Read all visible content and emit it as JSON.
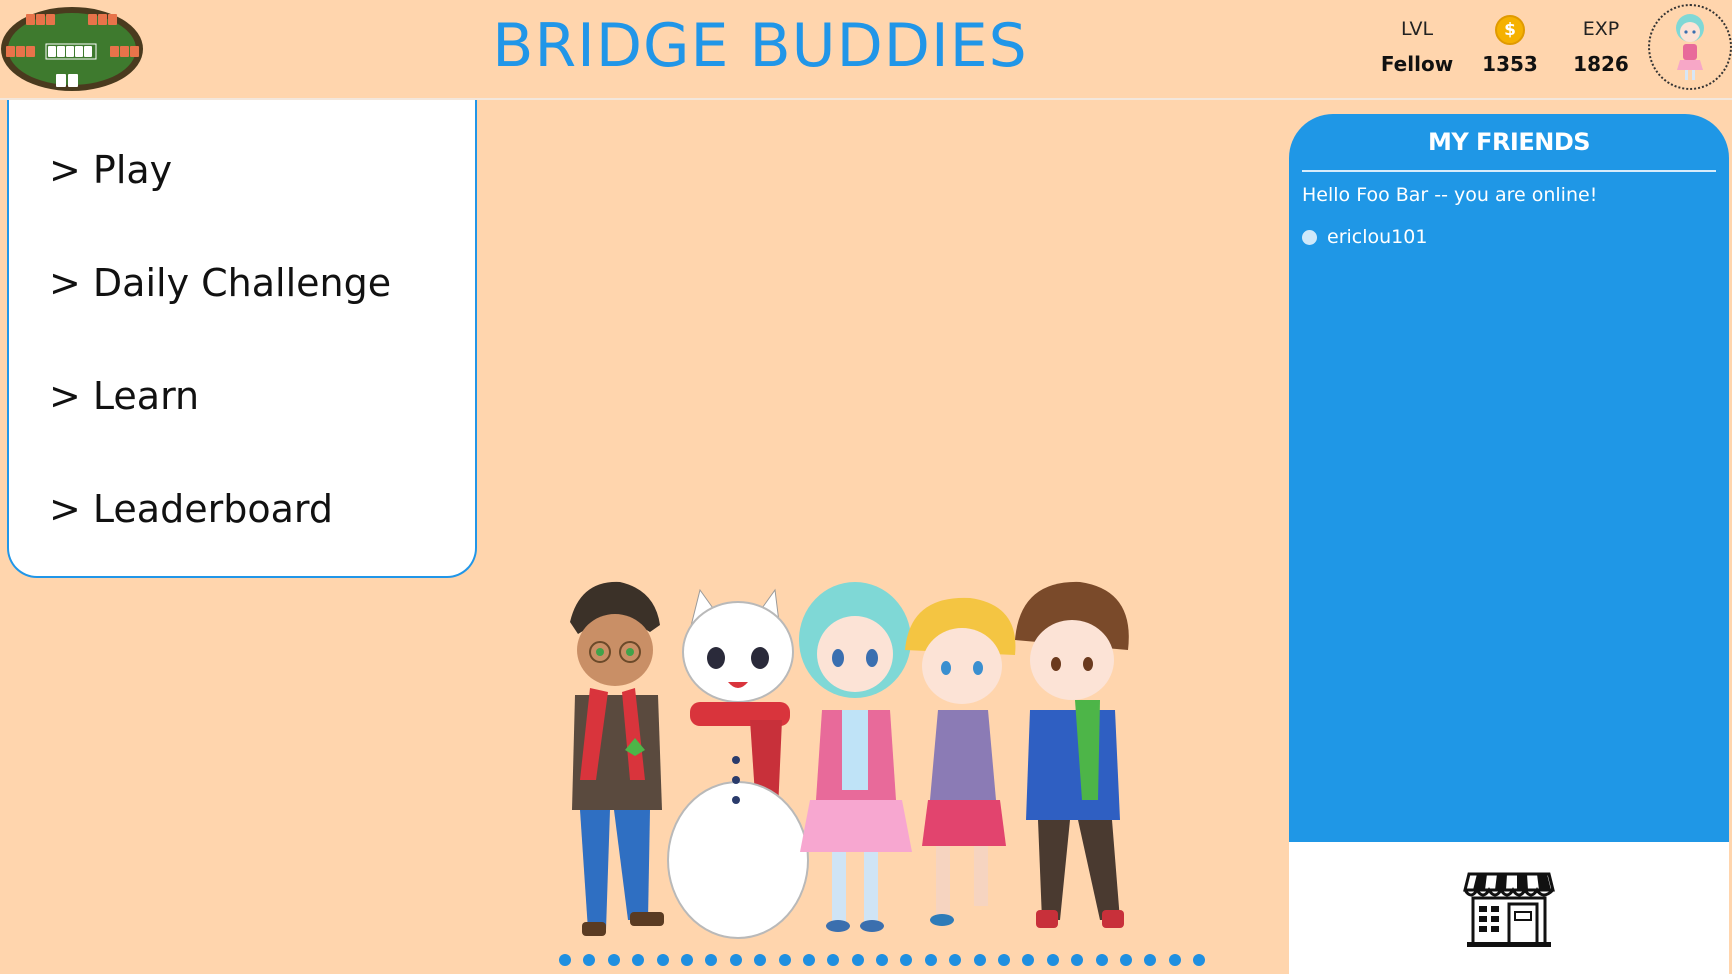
{
  "header": {
    "title": "BRIDGE BUDDIES",
    "logo_icon": "card-table-icon",
    "stats": {
      "level_label": "LVL",
      "level_value": "Fellow",
      "coins_icon": "coin-icon",
      "coins_symbol": "$",
      "coins_value": "1353",
      "exp_label": "EXP",
      "exp_value": "1826"
    },
    "avatar_icon": "avatar-icon"
  },
  "menu": {
    "items": [
      {
        "label": "> Play"
      },
      {
        "label": "> Daily Challenge"
      },
      {
        "label": "> Learn"
      },
      {
        "label": "> Leaderboard"
      }
    ]
  },
  "friends": {
    "title": "MY FRIENDS",
    "status_message": "Hello Foo Bar -- you are online!",
    "list": [
      {
        "name": "ericlou101",
        "status": "online"
      }
    ]
  },
  "shop": {
    "icon": "shop-icon"
  },
  "carousel": {
    "dot_count": 27
  },
  "colors": {
    "background": "#FFD5AD",
    "accent": "#2196E8",
    "friends_panel": "#1F97E6",
    "coin": "#F5B100"
  }
}
